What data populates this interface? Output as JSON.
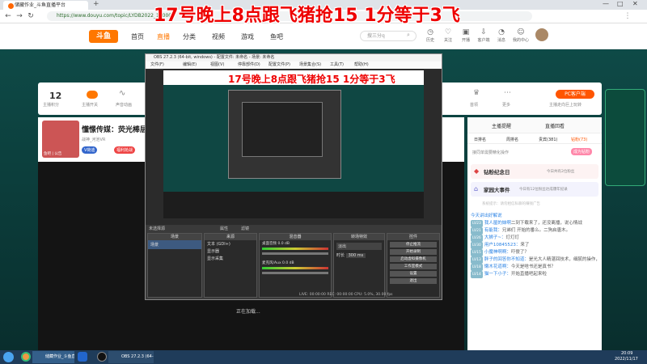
{
  "overlay_title": "17号晚上8点跟飞猪抢15 1分等于3飞",
  "obs_overlay_title": "17号晚上8点跟飞猪抢15 1分等于3飞",
  "browser": {
    "tab_title": "储藏作业_斗鱼直播平台",
    "url": "https://www.douyu.com/topic/LYDB2022_180000"
  },
  "douyu": {
    "logo": "斗鱼",
    "nav": [
      "首页",
      "直播",
      "分类",
      "视频",
      "游戏",
      "鱼吧"
    ],
    "search_placeholder": "搜三分q",
    "header_icons": [
      "历史",
      "关注",
      "开播",
      "客户端",
      "消息",
      "我的中心"
    ],
    "room_stat_value": "12",
    "room_stat_label": "主播积分",
    "room_icons": [
      "主播开关",
      "声音动画",
      "首领",
      "更多"
    ],
    "pc_client_btn": "PC客户端",
    "pc_client_sub": "主播走向巨上玩转",
    "streamer_name": "懂憬传媒：荧光棒层",
    "streamer_meta": "战神_河池VR",
    "vip_badge": "V荷迪",
    "fan_badge": "福利抢战",
    "streamer_av_text": "鱼吧 | 公告",
    "center_text": "正在加载..."
  },
  "chat": {
    "tabs": [
      "主播提醒",
      "直播回看"
    ],
    "sub_tabs": [
      "日排名",
      "周排名",
      "贵宾(381)",
      "钻粉(73)"
    ],
    "open_fan": "成为钻粉",
    "gift_tip": "接同单需要精化操作",
    "fan_day": "钻粉纪念日",
    "fan_day_sub": "今日共有2位粉丝",
    "event": "家园大事件",
    "event_sub": "今日有12位粉丝达成爆年纪录",
    "notice": "系统提示：请勿相信私聊的赚钱广告",
    "lines": [
      {
        "lv": "",
        "user": "今天讲出好解说",
        "text": ""
      },
      {
        "lv": "LV23",
        "user": "我人屋的妹啊",
        "text": "二到下载来了，还没离播，说心情战"
      },
      {
        "lv": "LV21",
        "user": "有能我：",
        "text": "兄弟们 开始的番么。二狗启唐木。"
      },
      {
        "lv": "LV26",
        "user": "大狮子~：",
        "text": "灯灯灯"
      },
      {
        "lv": "LV30",
        "user": "用户10845523：",
        "text": "来了"
      },
      {
        "lv": "LV15",
        "user": "小魔神啊啊：",
        "text": "吓傻了？"
      },
      {
        "lv": "LV13",
        "user": "胖子的回答你不知道：",
        "text": "是光大人精湛回技术，细腻的操作，完美的意识……让我们一起给你点赞！！！"
      },
      {
        "lv": "LV18",
        "user": "懒木花道啊：",
        "text": "今天是啥书还是真书？"
      },
      {
        "lv": "LV14",
        "user": "猫一下小子：",
        "text": "开始直播吧起来啦"
      }
    ]
  },
  "obs": {
    "window_title": "OBS 27.2.3 (64-bit, windows) - 配置文件: 未命名 - 场景: 未命名",
    "menu": [
      "文件(F)",
      "编辑(E)",
      "视图(V)",
      "停靠部件(D)",
      "配置文件(P)",
      "场景集合(S)",
      "工具(T)",
      "帮助(H)"
    ],
    "no_source": "未选择源",
    "props_btn": "属性",
    "filter_btn": "滤镜",
    "dock_titles": [
      "场景",
      "来源",
      "混音器",
      "转场特效",
      "控件"
    ],
    "scene_item": "场景",
    "sources": [
      "文本 (GDI+)",
      "显示器",
      "显示采集"
    ],
    "mixer": [
      {
        "label": "桌面音频",
        "value": "0.0 dB"
      },
      {
        "label": "麦克风/Aux",
        "value": "0.0 dB"
      }
    ],
    "transition": "淡出",
    "duration_label": "时长",
    "duration_value": "300 ms",
    "controls": [
      "停止推流",
      "开始录制",
      "启动虚拟摄像机",
      "工作室模式",
      "设置",
      "退出"
    ],
    "status": "LIVE: 00:00:00   REC: 00:00:00   CPU: 5.0%, 30.00 fps"
  },
  "taskbar": {
    "items": [
      "储藏作业_斗鱼直播...",
      "OBS 27.2.3 (64-bi..."
    ],
    "time": "20:09",
    "date": "2022/11/17"
  }
}
